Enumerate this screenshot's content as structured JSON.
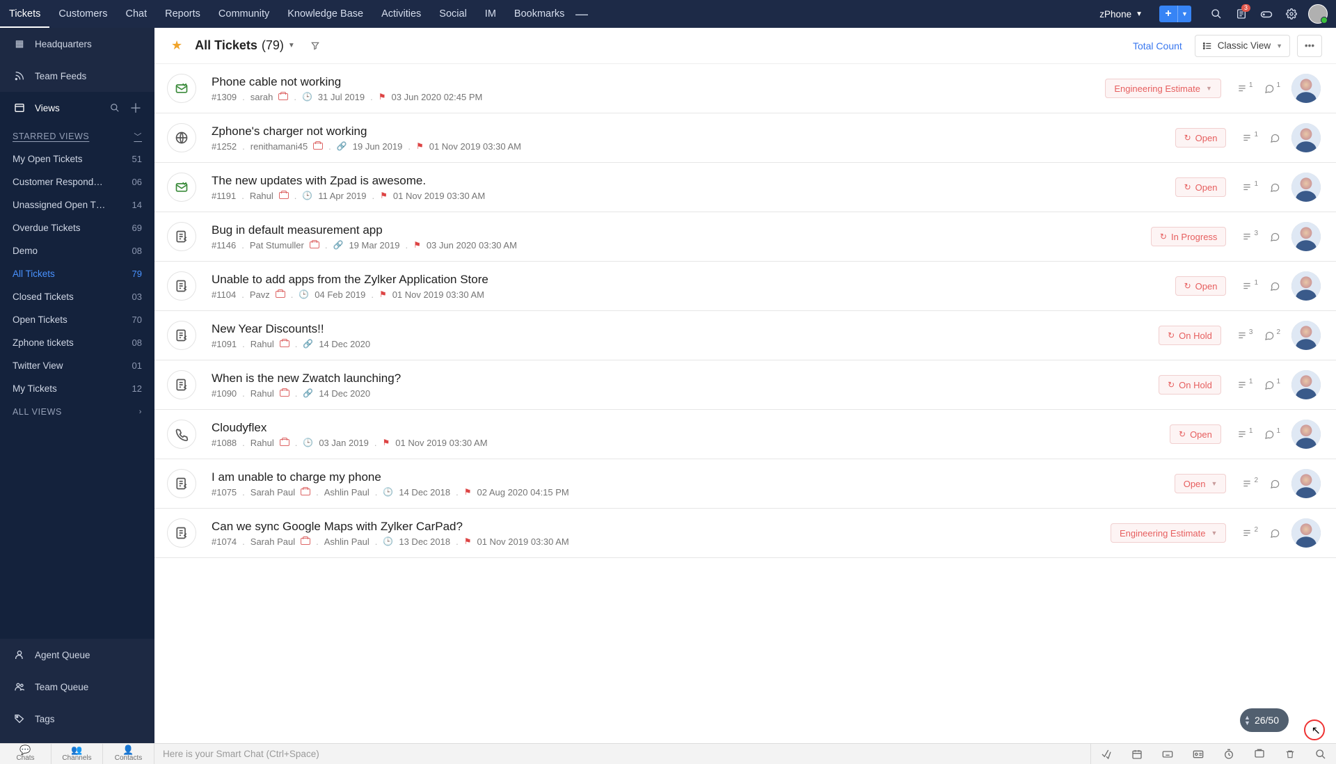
{
  "topnav": {
    "tabs": [
      "Tickets",
      "Customers",
      "Chat",
      "Reports",
      "Community",
      "Knowledge Base",
      "Activities",
      "Social",
      "IM",
      "Bookmarks"
    ],
    "active_tab": "Tickets",
    "org_label": "zPhone",
    "notif_count": "3"
  },
  "sidebar": {
    "items": [
      {
        "label": "Headquarters"
      },
      {
        "label": "Team Feeds"
      },
      {
        "label": "Views"
      }
    ],
    "starred_header": "STARRED VIEWS",
    "starred": [
      {
        "label": "My Open Tickets",
        "count": "51"
      },
      {
        "label": "Customer Respond…",
        "count": "06"
      },
      {
        "label": "Unassigned Open T…",
        "count": "14"
      },
      {
        "label": "Overdue Tickets",
        "count": "69"
      },
      {
        "label": "Demo",
        "count": "08"
      },
      {
        "label": "All Tickets",
        "count": "79",
        "active": true
      },
      {
        "label": "Closed Tickets",
        "count": "03"
      },
      {
        "label": "Open Tickets",
        "count": "70"
      },
      {
        "label": "Zphone tickets",
        "count": "08"
      },
      {
        "label": "Twitter View",
        "count": "01"
      },
      {
        "label": "My Tickets",
        "count": "12"
      }
    ],
    "all_views_header": "ALL VIEWS",
    "footer": [
      {
        "label": "Agent Queue"
      },
      {
        "label": "Team Queue"
      },
      {
        "label": "Tags"
      }
    ]
  },
  "toolbar": {
    "title": "All Tickets",
    "count": "(79)",
    "total_count": "Total Count",
    "view_mode": "Classic View"
  },
  "tickets": [
    {
      "channel": "mail",
      "title": "Phone cable not working",
      "id": "#1309",
      "owner": "sarah",
      "created": "31 Jul 2019",
      "due": "03 Jun 2020 02:45 PM",
      "status": "Engineering Estimate",
      "status_drop": true,
      "list": "1",
      "comments": "1",
      "link": false
    },
    {
      "channel": "web",
      "title": "Zphone's charger not working",
      "id": "#1252",
      "owner": "renithamani45",
      "created": "19 Jun 2019",
      "due": "01 Nov 2019 03:30 AM",
      "status": "Open",
      "list": "1",
      "comments": "",
      "link": true
    },
    {
      "channel": "mail",
      "title": "The new updates with Zpad is awesome.",
      "id": "#1191",
      "owner": "Rahul",
      "created": "11 Apr 2019",
      "due": "01 Nov 2019 03:30 AM",
      "status": "Open",
      "list": "1",
      "comments": "",
      "link": false
    },
    {
      "channel": "form",
      "title": "Bug in default measurement app",
      "id": "#1146",
      "owner": "Pat Stumuller",
      "created": "19 Mar 2019",
      "due": "03 Jun 2020 03:30 AM",
      "status": "In Progress",
      "list": "3",
      "comments": "",
      "link": true
    },
    {
      "channel": "form",
      "title": "Unable to add apps from the Zylker Application Store",
      "id": "#1104",
      "owner": "Pavz",
      "created": "04 Feb 2019",
      "due": "01 Nov 2019 03:30 AM",
      "status": "Open",
      "list": "1",
      "comments": "",
      "link": false
    },
    {
      "channel": "form",
      "title": "New Year Discounts!!",
      "id": "#1091",
      "owner": "Rahul",
      "created": "14 Dec 2020",
      "due": "",
      "status": "On Hold",
      "list": "3",
      "comments": "2",
      "link": true
    },
    {
      "channel": "form",
      "title": "When is the new Zwatch launching?",
      "id": "#1090",
      "owner": "Rahul",
      "created": "14 Dec 2020",
      "due": "",
      "status": "On Hold",
      "list": "1",
      "comments": "1",
      "link": true
    },
    {
      "channel": "phone",
      "title": "Cloudyflex",
      "id": "#1088",
      "owner": "Rahul",
      "created": "03 Jan 2019",
      "due": "01 Nov 2019 03:30 AM",
      "status": "Open",
      "list": "1",
      "comments": "1",
      "link": false
    },
    {
      "channel": "form",
      "title": "I am unable to charge my phone",
      "id": "#1075",
      "owner": "Sarah Paul",
      "owner2": "Ashlin Paul",
      "created": "14 Dec 2018",
      "due": "02 Aug 2020 04:15 PM",
      "status": "Open",
      "status_drop": true,
      "list": "2",
      "comments": "",
      "link": false
    },
    {
      "channel": "form",
      "title": "Can we sync Google Maps with Zylker CarPad?",
      "id": "#1074",
      "owner": "Sarah Paul",
      "owner2": "Ashlin Paul",
      "created": "13 Dec 2018",
      "due": "01 Nov 2019 03:30 AM",
      "status": "Engineering Estimate",
      "status_drop": true,
      "list": "2",
      "comments": "",
      "link": false
    }
  ],
  "pager": "26/50",
  "bottom": {
    "tabs": [
      "Chats",
      "Channels",
      "Contacts"
    ],
    "smart_placeholder": "Here is your Smart Chat (Ctrl+Space)"
  }
}
